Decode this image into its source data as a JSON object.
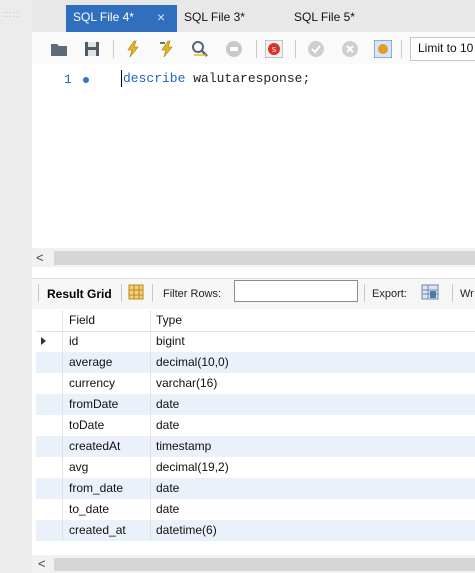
{
  "tabs": [
    {
      "label": "SQL File 4*",
      "active": true
    },
    {
      "label": "SQL File 3*",
      "active": false
    },
    {
      "label": "SQL File 5*",
      "active": false
    }
  ],
  "toolbar": {
    "icons": [
      "open-folder-icon",
      "save-icon",
      "execute-icon",
      "execute-current-icon",
      "explain-icon",
      "stop-icon",
      "toggle-error-icon",
      "commit-icon",
      "rollback-icon",
      "autocommit-icon"
    ],
    "limit_label": "Limit to 10"
  },
  "editor": {
    "line_number": "1",
    "keyword": "describe",
    "rest": " walutaresponse;"
  },
  "result": {
    "grid_label": "Result Grid",
    "filter_label": "Filter Rows:",
    "filter_value": "",
    "export_label": "Export:",
    "wrap_label": "Wr",
    "columns": [
      "Field",
      "Type"
    ],
    "rows": [
      {
        "field": "id",
        "type": "bigint"
      },
      {
        "field": "average",
        "type": "decimal(10,0)"
      },
      {
        "field": "currency",
        "type": "varchar(16)"
      },
      {
        "field": "fromDate",
        "type": "date"
      },
      {
        "field": "toDate",
        "type": "date"
      },
      {
        "field": "createdAt",
        "type": "timestamp"
      },
      {
        "field": "avg",
        "type": "decimal(19,2)"
      },
      {
        "field": "from_date",
        "type": "date"
      },
      {
        "field": "to_date",
        "type": "date"
      },
      {
        "field": "created_at",
        "type": "datetime(6)"
      }
    ]
  },
  "colors": {
    "active_tab": "#2f6fbd",
    "row_alt": "#eaf1fb",
    "keyword": "#1f65c5"
  }
}
